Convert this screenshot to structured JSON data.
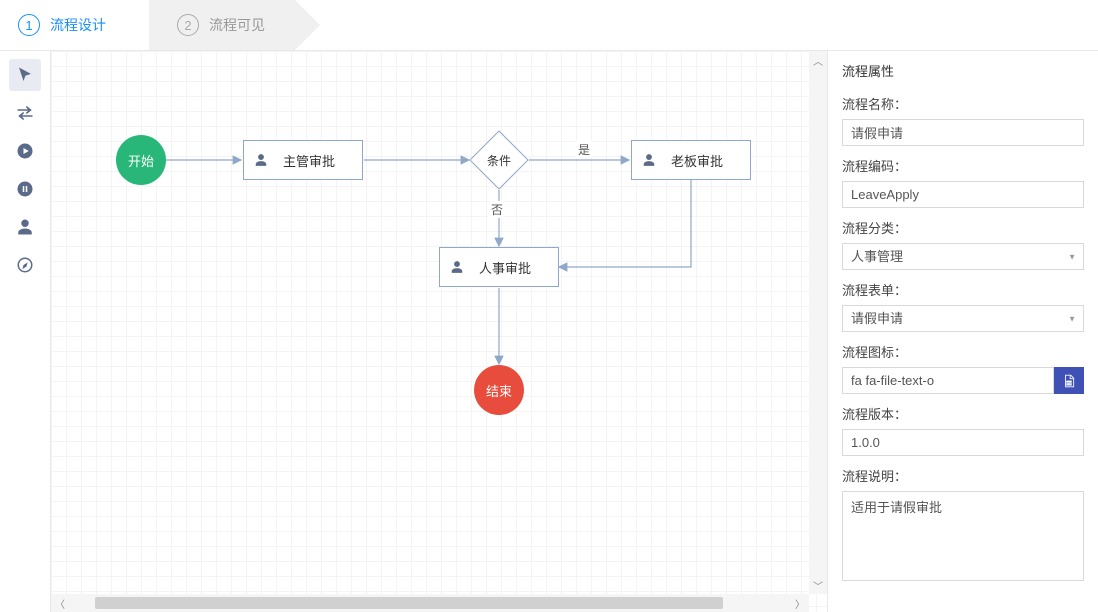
{
  "steps": {
    "s1": "流程设计",
    "s2": "流程可见"
  },
  "flow": {
    "start": "开始",
    "end": "结束",
    "task1": "主管审批",
    "task2": "老板审批",
    "task3": "人事审批",
    "cond": "条件",
    "yes": "是",
    "no": "否"
  },
  "panel": {
    "title": "流程属性",
    "name_label": "流程名称：",
    "name_value": "请假申请",
    "code_label": "流程编码：",
    "code_value": "LeaveApply",
    "category_label": "流程分类：",
    "category_value": "人事管理",
    "form_label": "流程表单：",
    "form_value": "请假申请",
    "icon_label": "流程图标：",
    "icon_value": "fa fa-file-text-o",
    "version_label": "流程版本：",
    "version_value": "1.0.0",
    "desc_label": "流程说明：",
    "desc_value": "适用于请假审批"
  }
}
